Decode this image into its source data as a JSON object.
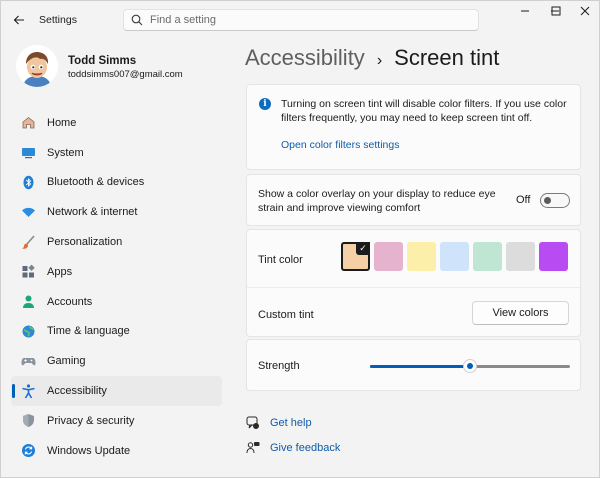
{
  "window": {
    "app_title": "Settings",
    "search_placeholder": "Find a setting",
    "controls": {
      "minimize": "minimize-icon",
      "maximize": "maximize-icon",
      "close": "close-icon"
    }
  },
  "profile": {
    "name": "Todd Simms",
    "email": "toddsimms007@gmail.com"
  },
  "nav": {
    "items": [
      {
        "label": "Home",
        "icon": "home-icon"
      },
      {
        "label": "System",
        "icon": "system-icon"
      },
      {
        "label": "Bluetooth & devices",
        "icon": "bluetooth-icon"
      },
      {
        "label": "Network & internet",
        "icon": "wifi-icon"
      },
      {
        "label": "Personalization",
        "icon": "brush-icon"
      },
      {
        "label": "Apps",
        "icon": "apps-icon"
      },
      {
        "label": "Accounts",
        "icon": "accounts-icon"
      },
      {
        "label": "Time & language",
        "icon": "globe-icon"
      },
      {
        "label": "Gaming",
        "icon": "gamepad-icon"
      },
      {
        "label": "Accessibility",
        "icon": "accessibility-icon",
        "active": true
      },
      {
        "label": "Privacy & security",
        "icon": "shield-icon"
      },
      {
        "label": "Windows Update",
        "icon": "update-icon"
      }
    ]
  },
  "breadcrumb": {
    "parent": "Accessibility",
    "separator": "›",
    "current": "Screen tint"
  },
  "info": {
    "text": "Turning on screen tint will disable color filters. If you use color filters frequently, you may need to keep screen tint off.",
    "link": "Open color filters settings"
  },
  "overlay": {
    "description": "Show a color overlay on your display to reduce eye strain and improve viewing comfort",
    "state": "Off",
    "on": false
  },
  "tint": {
    "label": "Tint color",
    "colors": [
      "#f5cfa6",
      "#e6b3cf",
      "#fcefa9",
      "#cfe3fa",
      "#bfe6d2",
      "#dcdcdc",
      "#b84cf2"
    ],
    "selected_index": 0,
    "check_glyph": "✓"
  },
  "custom_tint": {
    "label": "Custom tint",
    "button": "View colors"
  },
  "strength": {
    "label": "Strength",
    "value_fraction": 0.5,
    "accent": "#005fb8"
  },
  "help": {
    "get_help": "Get help",
    "give_feedback": "Give feedback"
  }
}
